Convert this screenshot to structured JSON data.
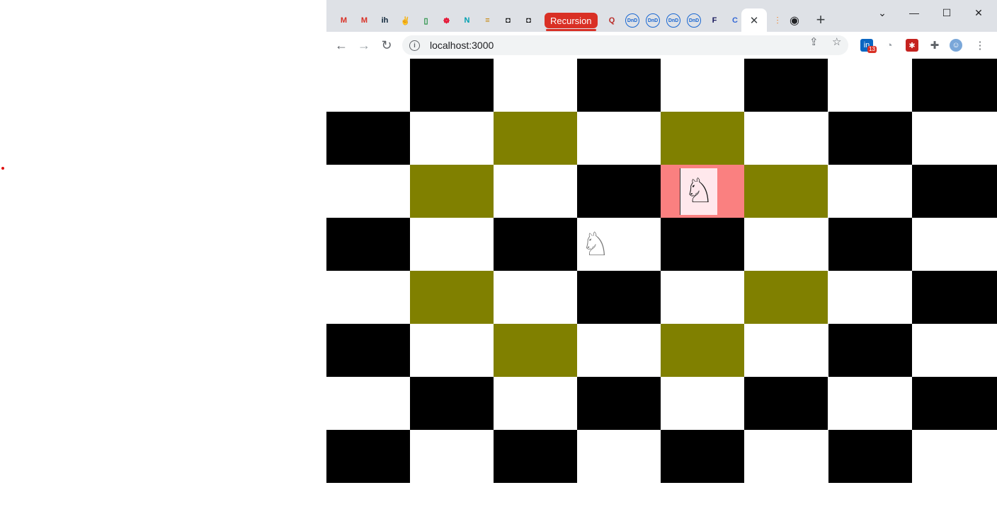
{
  "browser": {
    "tab_group_label": "Recursion",
    "tabs": [
      {
        "icon": "gmail-icon",
        "glyph": "M",
        "color": "#d93025"
      },
      {
        "icon": "gmail-icon",
        "glyph": "M",
        "color": "#d93025"
      },
      {
        "icon": "indiehackers-icon",
        "glyph": "ih",
        "color": "#0e2439"
      },
      {
        "icon": "peace-hand-icon",
        "glyph": "✌",
        "color": "#202124"
      },
      {
        "icon": "phone-icon",
        "glyph": "▯",
        "color": "#1e8e3e"
      },
      {
        "icon": "pinterest-icon",
        "glyph": "☸",
        "color": "#e60023"
      },
      {
        "icon": "n-icon",
        "glyph": "N",
        "color": "#00a0b0"
      },
      {
        "icon": "lines-icon",
        "glyph": "≡",
        "color": "#c58200"
      },
      {
        "icon": "gitbook-icon",
        "glyph": "◘",
        "color": "#000000"
      },
      {
        "icon": "gitbook-icon",
        "glyph": "◘",
        "color": "#000000"
      },
      {
        "icon": "quora-icon",
        "glyph": "Q",
        "color": "#b92b27"
      },
      {
        "icon": "dnd-icon",
        "glyph": "DnD",
        "color": "#1967d2"
      },
      {
        "icon": "dnd-icon",
        "glyph": "DnD",
        "color": "#1967d2"
      },
      {
        "icon": "dnd-icon",
        "glyph": "DnD",
        "color": "#1967d2"
      },
      {
        "icon": "dnd-icon",
        "glyph": "DnD",
        "color": "#1967d2"
      },
      {
        "icon": "f-icon",
        "glyph": "F",
        "color": "#1a1a5e"
      },
      {
        "icon": "c-icon",
        "glyph": "C",
        "color": "#3367d6"
      }
    ],
    "active_tab_close": "✕",
    "active_tab_favicon": "stackoverflow-icon",
    "new_tab_glyph": "+",
    "url": "localhost:3000",
    "extension_badge": "13"
  },
  "board": {
    "rows": 8,
    "cols": 8,
    "colors": {
      "light": "#ffffff",
      "dark": "#000000",
      "move": "#808000",
      "selected": "#fa8080"
    },
    "move_squares": [
      [
        1,
        2
      ],
      [
        1,
        4
      ],
      [
        2,
        1
      ],
      [
        2,
        5
      ],
      [
        4,
        1
      ],
      [
        4,
        5
      ],
      [
        5,
        2
      ],
      [
        5,
        4
      ]
    ],
    "selected_square": [
      2,
      4
    ],
    "knight": {
      "row": 2,
      "col": 4,
      "glyph": "♘"
    },
    "drag_ghost": {
      "row": 3,
      "col": 3,
      "glyph": "♘"
    }
  }
}
